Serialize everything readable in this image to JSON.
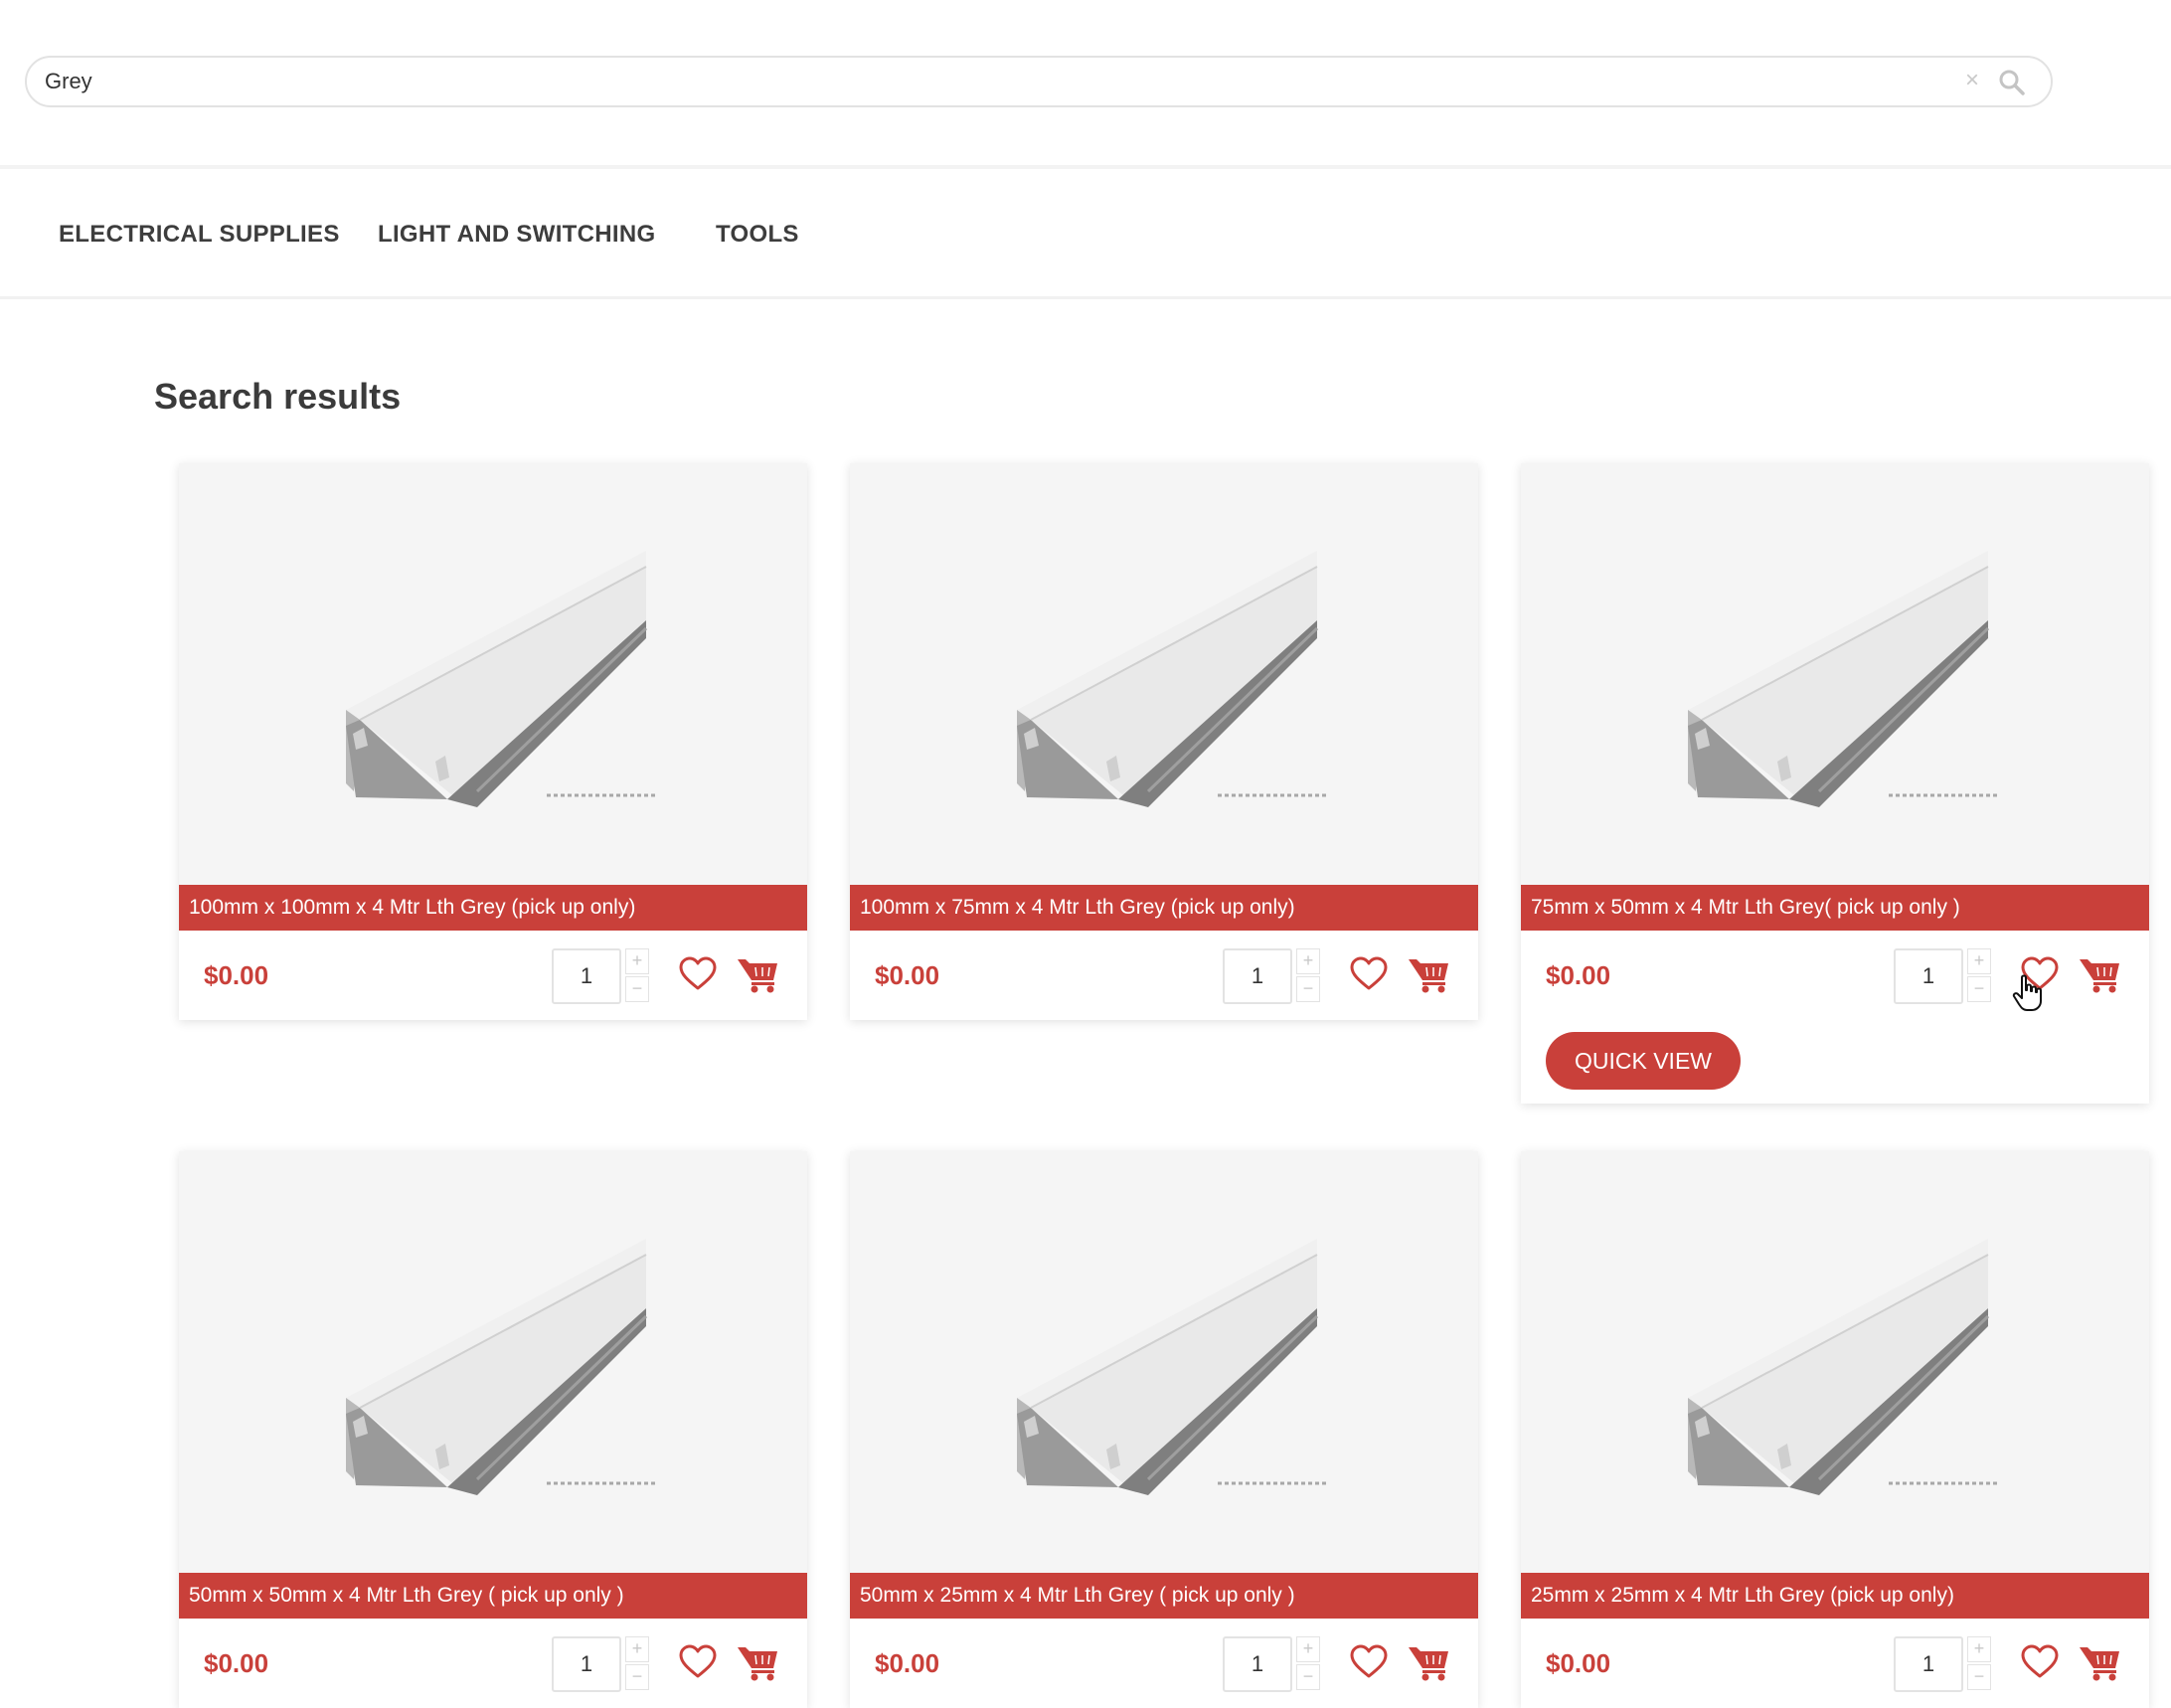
{
  "search": {
    "value": "Grey",
    "clear_glyph": "×",
    "icon": "search-icon"
  },
  "nav": {
    "items": [
      "ELECTRICAL SUPPLIES",
      "LIGHT AND SWITCHING",
      "TOOLS"
    ]
  },
  "page_title": "Search results",
  "products": [
    {
      "title": "100mm x 100mm x 4 Mtr Lth Grey (pick up only)",
      "price": "$0.00",
      "quantity": "1"
    },
    {
      "title": "100mm x 75mm x 4 Mtr Lth Grey (pick up only)",
      "price": "$0.00",
      "quantity": "1"
    },
    {
      "title": "75mm x 50mm x 4 Mtr Lth Grey( pick up only )",
      "price": "$0.00",
      "quantity": "1",
      "quick_view_label": "QUICK VIEW"
    },
    {
      "title": "50mm x 50mm x 4 Mtr Lth Grey ( pick up only )",
      "price": "$0.00",
      "quantity": "1"
    },
    {
      "title": "50mm x 25mm x 4 Mtr Lth Grey ( pick up only )",
      "price": "$0.00",
      "quantity": "1"
    },
    {
      "title": "25mm x 25mm x 4 Mtr Lth Grey (pick up only)",
      "price": "$0.00",
      "quantity": "1"
    }
  ],
  "controls": {
    "qty_plus": "+",
    "qty_minus": "−"
  },
  "icons": {
    "wishlist": "heart-icon",
    "cart": "cart-icon",
    "pointer": "hand-cursor-icon"
  },
  "colors": {
    "accent": "#c9403a",
    "title_bar": "#c9403a",
    "background": "#ffffff"
  }
}
